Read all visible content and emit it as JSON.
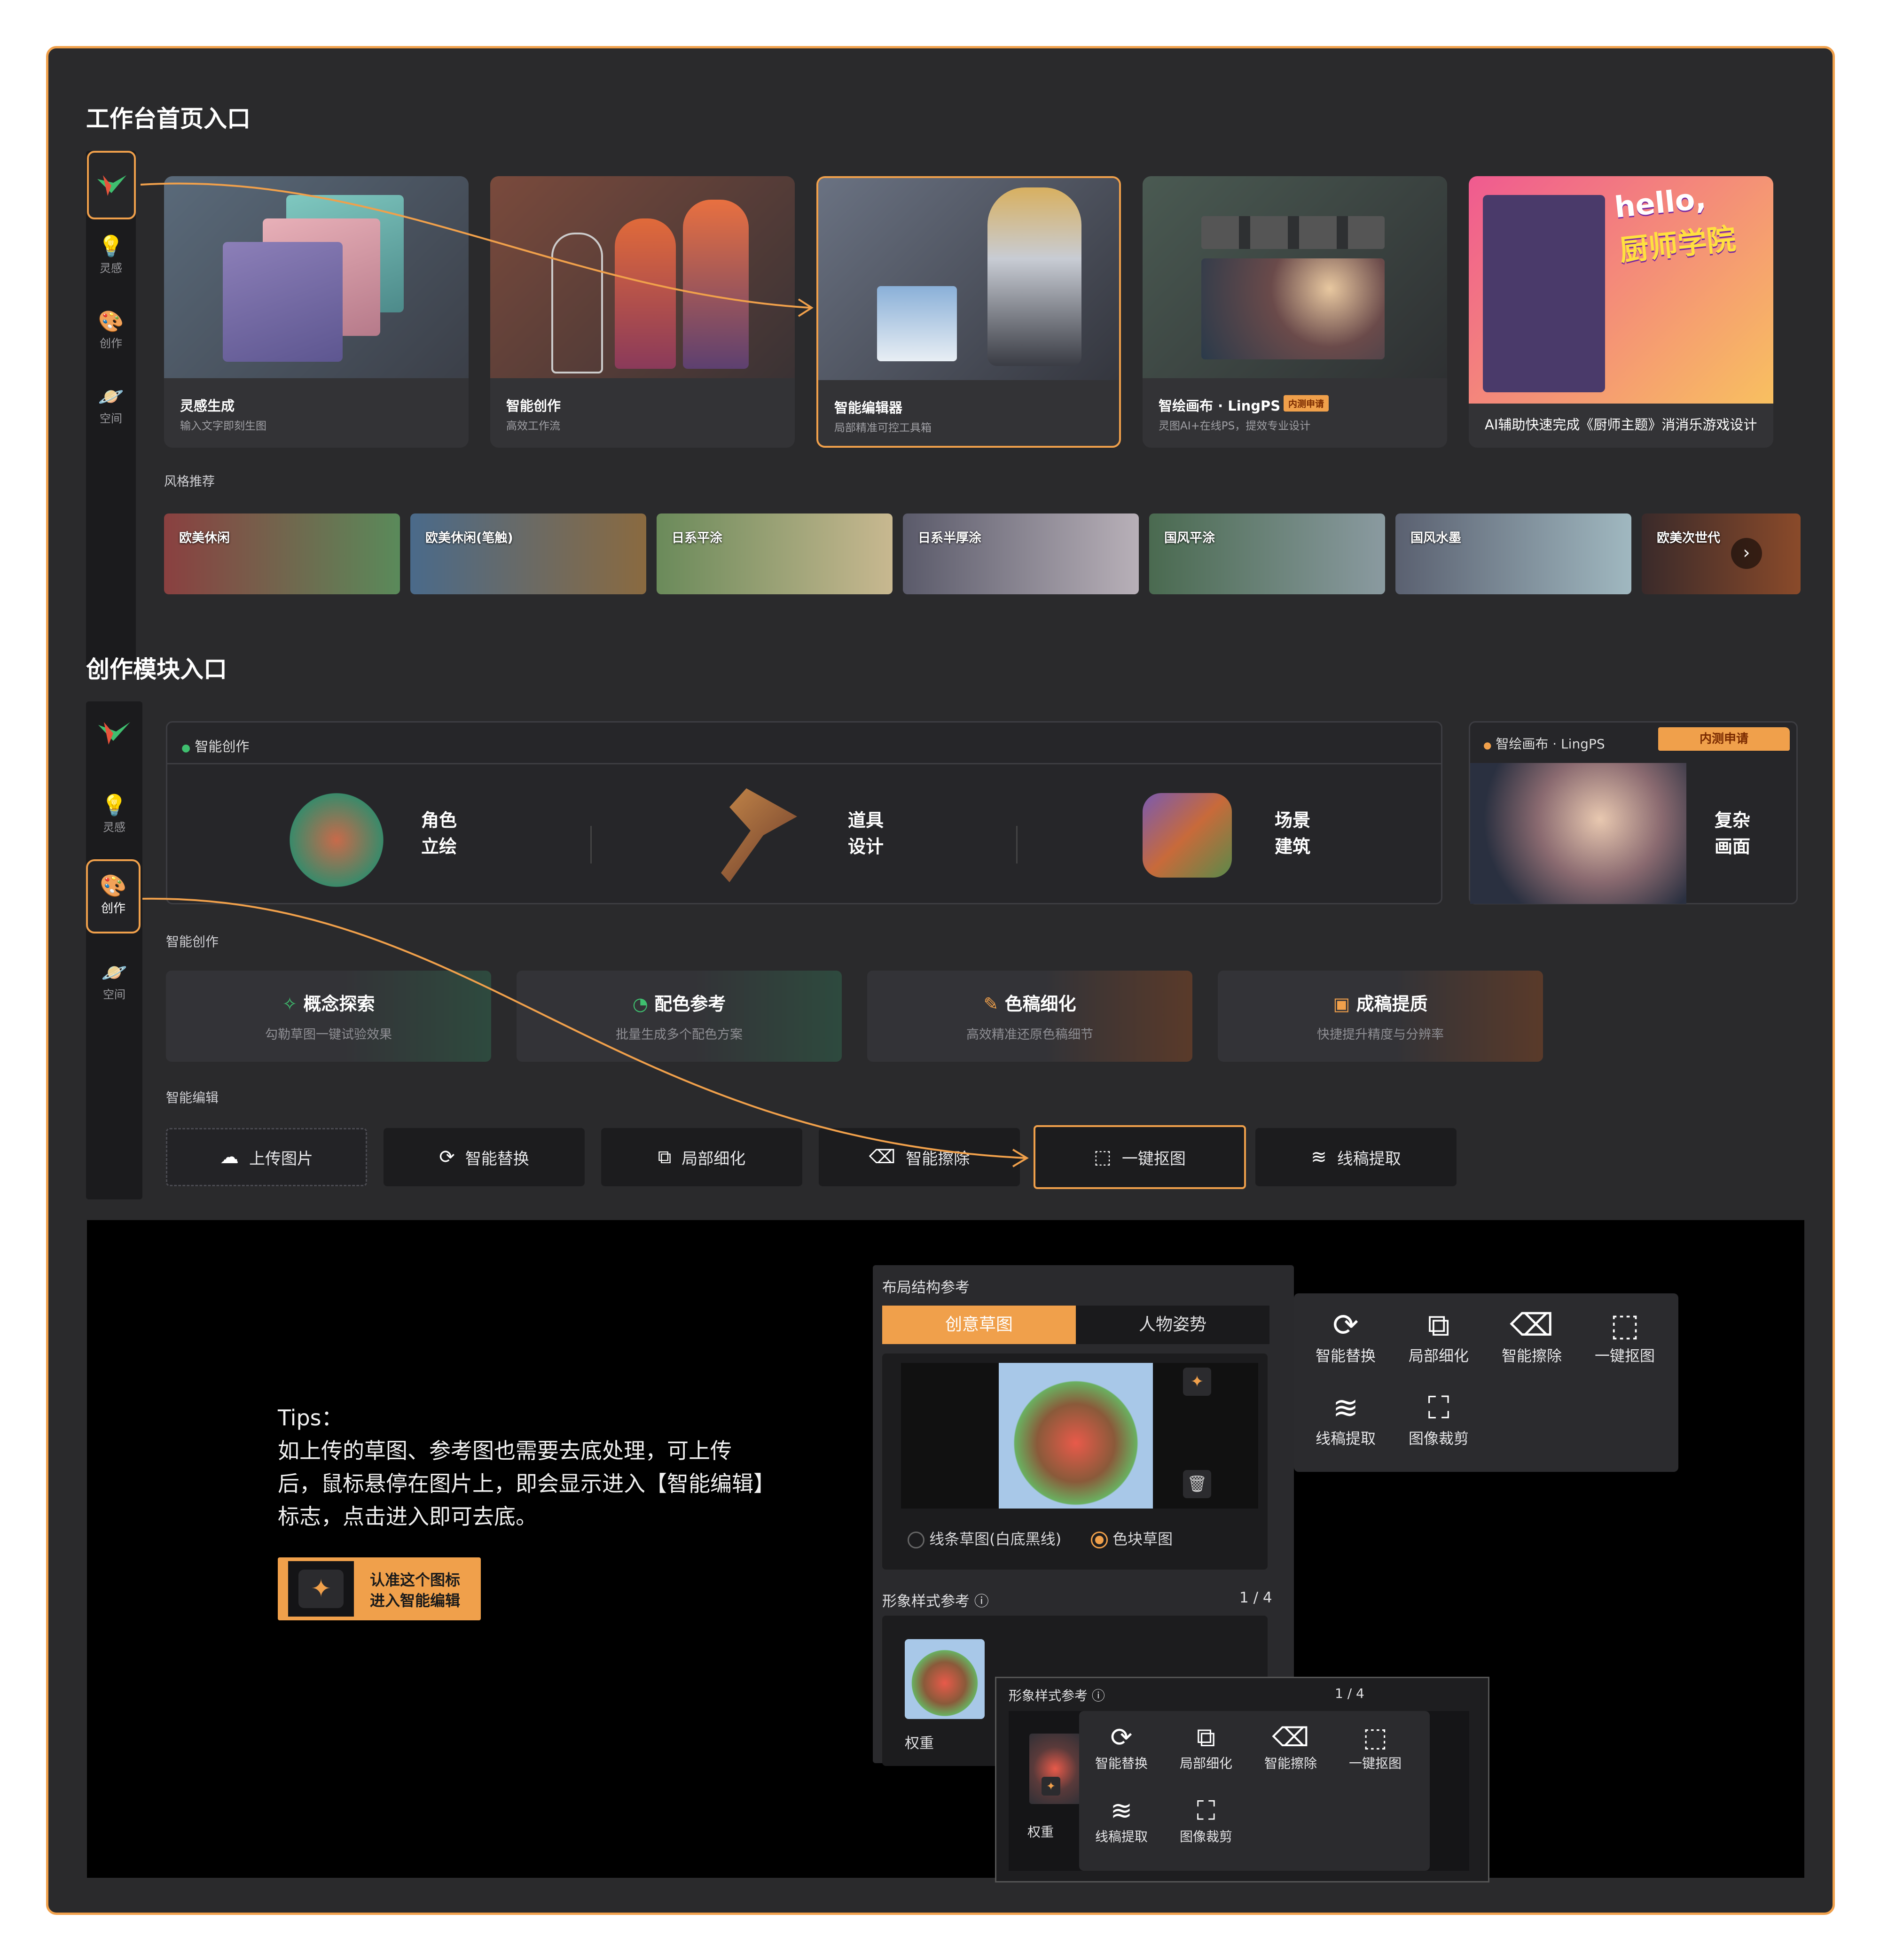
{
  "sections": {
    "home_title": "工作台首页入口",
    "create_title": "创作模块入口"
  },
  "sidebar": {
    "items": [
      {
        "label": "灵感"
      },
      {
        "label": "创作"
      },
      {
        "label": "空间"
      }
    ]
  },
  "home_cards": [
    {
      "title": "灵感生成",
      "desc": "输入文字即刻生图"
    },
    {
      "title": "智能创作",
      "desc": "高效工作流"
    },
    {
      "title": "智能编辑器",
      "desc": "局部精准可控工具箱"
    },
    {
      "title": "智绘画布 · LingPS",
      "desc": "灵图AI+在线PS，提效专业设计",
      "badge": "内测申请"
    },
    {
      "title": "AI辅助快速完成《厨师主题》消消乐游戏设计",
      "poster_text_1": "hello,",
      "poster_text_2": "厨师学院"
    }
  ],
  "style_rec": {
    "label": "风格推荐",
    "items": [
      "欧美休闲",
      "欧美休闲(笔触)",
      "日系平涂",
      "日系半厚涂",
      "国风平涂",
      "国风水墨",
      "欧美次世代"
    ]
  },
  "smart_create_panel": {
    "tab": "智能创作",
    "items": [
      {
        "line1": "角色",
        "line2": "立绘"
      },
      {
        "line1": "道具",
        "line2": "设计"
      },
      {
        "line1": "场景",
        "line2": "建筑"
      }
    ]
  },
  "lingps_panel": {
    "tab": "智绘画布 · LingPS",
    "badge": "内测申请",
    "line1": "复杂",
    "line2": "画面"
  },
  "smart_create_label": "智能创作",
  "tool_cards": [
    {
      "title": "概念探索",
      "desc": "勾勒草图一键试验效果"
    },
    {
      "title": "配色参考",
      "desc": "批量生成多个配色方案"
    },
    {
      "title": "色稿细化",
      "desc": "高效精准还原色稿细节"
    },
    {
      "title": "成稿提质",
      "desc": "快捷提升精度与分辨率"
    }
  ],
  "smart_edit_label": "智能编辑",
  "edit_buttons": [
    "上传图片",
    "智能替换",
    "局部细化",
    "智能擦除",
    "一键抠图",
    "线稿提取"
  ],
  "tips": {
    "title": "Tips：",
    "body": "如上传的草图、参考图也需要去底处理，可上传后，鼠标悬停在图片上，即会显示进入【智能编辑】标志，点击进入即可去底。",
    "badge_line1": "认准这个图标",
    "badge_line2": "进入智能编辑"
  },
  "layout_ref": {
    "title": "布局结构参考",
    "tabs": [
      "创意草图",
      "人物姿势"
    ],
    "radio_options": [
      "线条草图(白底黑线)",
      "色块草图"
    ],
    "style_ref_title": "形象样式参考",
    "style_ref_count": "1 / 4",
    "weight_label": "权重"
  },
  "popup_menu": [
    "智能替换",
    "局部细化",
    "智能擦除",
    "一键抠图",
    "线稿提取",
    "图像裁剪"
  ],
  "colors": {
    "accent": "#f0a04b",
    "frame_bg": "#2a2a2c",
    "panel_bg": "#262629"
  }
}
